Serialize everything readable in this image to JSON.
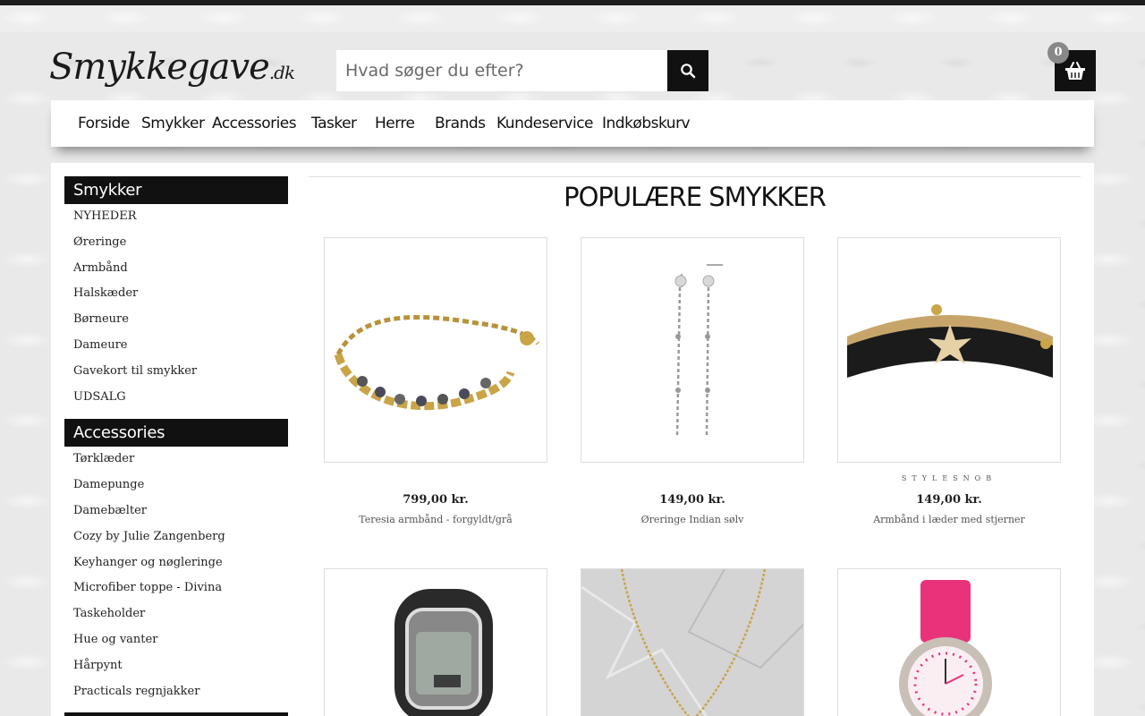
{
  "header": {
    "logo_main": "Smykkegave",
    "logo_suffix": ".dk",
    "search_placeholder": "Hvad søger du efter?",
    "cart_count": "0"
  },
  "nav": [
    "Forside",
    "Smykker",
    "Accessories",
    "Tasker",
    "Herre",
    "Brands",
    "Kundeservice",
    "Indkøbskurv"
  ],
  "sidebar": {
    "smykker_title": "Smykker",
    "smykker": [
      "NYHEDER",
      "Øreringe",
      "Armbånd",
      "Halskæder",
      "Børneure",
      "Dameure",
      "Gavekort til smykker",
      "UDSALG"
    ],
    "accessories_title": "Accessories",
    "accessories": [
      "Tørklæder",
      "Damepunge",
      "Damebælter",
      "Cozy by Julie Zangenberg",
      "Keyhanger og nøgleringe",
      "Microfiber toppe - Divina",
      "Taskeholder",
      "Hue og vanter",
      "Hårpynt",
      "Practicals regnjakker"
    ]
  },
  "main": {
    "title": "POPULÆRE SMYKKER",
    "products": [
      {
        "price": "799,00 kr.",
        "name": "Teresia armbånd - forgyldt/grå",
        "brand": ""
      },
      {
        "price": "149,00 kr.",
        "name": "Øreringe Indian sølv",
        "brand": ""
      },
      {
        "price": "149,00 kr.",
        "name": "Armbånd i læder med stjerner",
        "brand": "STYLESNOB"
      }
    ]
  },
  "colors": {
    "accent": "#111111",
    "gold": "#c9a548",
    "pink": "#e8337a"
  }
}
